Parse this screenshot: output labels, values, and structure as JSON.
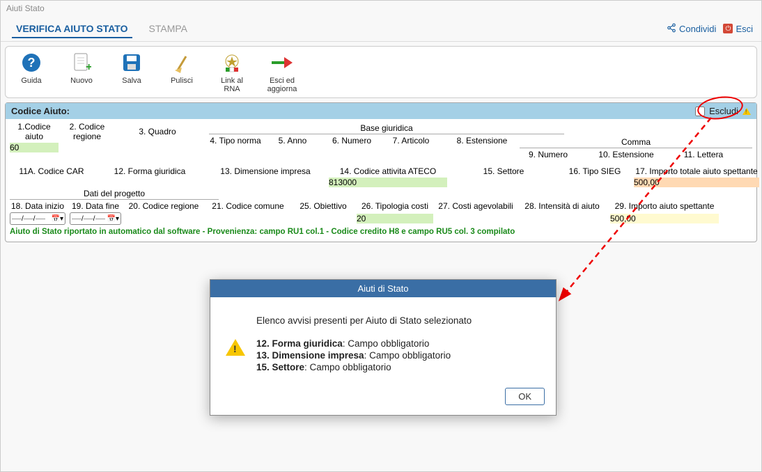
{
  "window": {
    "title": "Aiuti Stato"
  },
  "tabs": {
    "verifica": "VERIFICA AIUTO STATO",
    "stampa": "STAMPA"
  },
  "topbar": {
    "condividi": "Condividi",
    "esci": "Esci"
  },
  "toolbar": {
    "guida": "Guida",
    "nuovo": "Nuovo",
    "salva": "Salva",
    "pulisci": "Pulisci",
    "link_rna": "Link al\nRNA",
    "esci_aggiorna": "Esci ed\naggiorna"
  },
  "pane": {
    "title": "Codice Aiuto:",
    "escludi": "Escludi"
  },
  "groups": {
    "base_giuridica": "Base giuridica",
    "comma": "Comma",
    "dati_progetto": "Dati del progetto"
  },
  "r1": {
    "codice_aiuto": "1.Codice aiuto",
    "codice_regione": "2. Codice regione",
    "quadro": "3. Quadro",
    "tipo_norma": "4. Tipo norma",
    "anno": "5. Anno",
    "numero": "6. Numero",
    "articolo": "7. Articolo",
    "estensione": "8. Estensione",
    "c_numero": "9. Numero",
    "c_estensione": "10. Estensione",
    "c_lettera": "11. Lettera",
    "val_codice_aiuto": "60"
  },
  "r2": {
    "codice_car": "11A. Codice CAR",
    "forma_giuridica": "12. Forma giuridica",
    "dimensione_impresa": "13. Dimensione impresa",
    "codice_ateco": "14. Codice attivita ATECO",
    "settore": "15. Settore",
    "tipo_sieg": "16. Tipo SIEG",
    "importo_totale": "17. Importo totale aiuto spettante",
    "val_ateco": "813000",
    "val_importo": "500,00"
  },
  "r3": {
    "data_inizio": "18. Data inizio",
    "data_fine": "19. Data fine",
    "codice_regione": "20. Codice regione",
    "codice_comune": "21. Codice comune",
    "obiettivo": "25. Obiettivo",
    "tipologia_costi": "26. Tipologia costi",
    "costi_agevolabili": "27. Costi agevolabili",
    "intensita": "28. Intensità di aiuto",
    "importo_spettante": "29. Importo aiuto spettante",
    "val_tipologia": "20",
    "val_importo": "500,00"
  },
  "footnote": "Aiuto di Stato riportato in automatico dal software - Provenienza: campo RU1 col.1 - Codice credito H8 e campo RU5 col. 3 compilato",
  "modal": {
    "title": "Aiuti di Stato",
    "intro": "Elenco avvisi presenti per Aiuto di Stato selezionato",
    "l1b": "12. Forma giuridica",
    "l1r": ": Campo obbligatorio",
    "l2b": "13. Dimensione impresa",
    "l2r": ": Campo obbligatorio",
    "l3b": "15. Settore",
    "l3r": ": Campo obbligatorio",
    "ok": "OK"
  }
}
